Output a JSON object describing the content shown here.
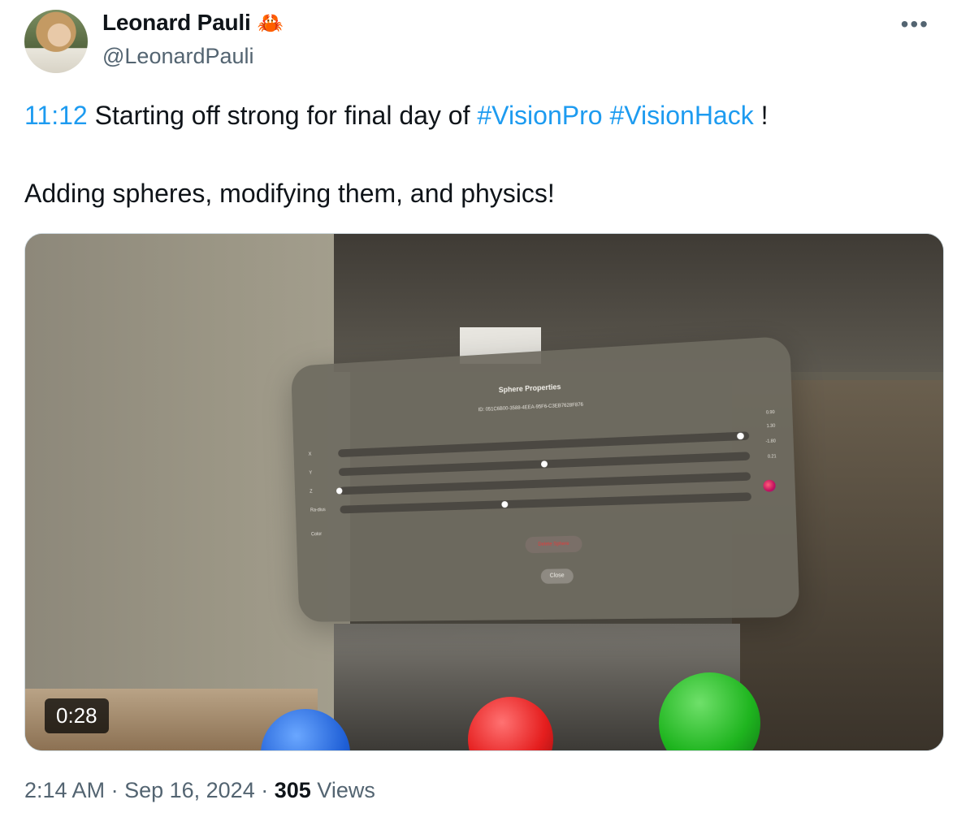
{
  "author": {
    "name": "Leonard Pauli",
    "emoji_icon": "crab-icon",
    "handle": "@LeonardPauli"
  },
  "more_icon": "more-horizontal-icon",
  "tweet": {
    "timestamp_link": "11:12",
    "text_part1": " Starting off strong for final day of ",
    "hashtag1": "#VisionPro",
    "hashtag2": "#VisionHack",
    "text_part2": " !",
    "line2": "Adding spheres, modifying them, and physics!"
  },
  "media": {
    "duration": "0:28",
    "panel": {
      "title": "Sphere Properties",
      "id": "ID: 051C6B00-3588-4EEA-95F6-C3EB7628F876",
      "sliders": [
        {
          "label": "X",
          "value": "1.30",
          "position": 0.98
        },
        {
          "label": "Y",
          "value": "-1.80",
          "position": 0.52
        },
        {
          "label": "Z",
          "value": "0.21",
          "position": 0.0
        },
        {
          "label": "Ra-dius",
          "value": "",
          "position": 0.42
        }
      ],
      "top_value": "0.90",
      "color_label": "Color",
      "delete_label": "Delete Sphere",
      "close_label": "Close"
    }
  },
  "meta": {
    "time": "2:14 AM",
    "date": "Sep 16, 2024",
    "views_count": "305",
    "views_label": "Views"
  },
  "colors": {
    "link": "#1d9bf0",
    "secondary_text": "#536471",
    "primary_text": "#0f1419"
  }
}
